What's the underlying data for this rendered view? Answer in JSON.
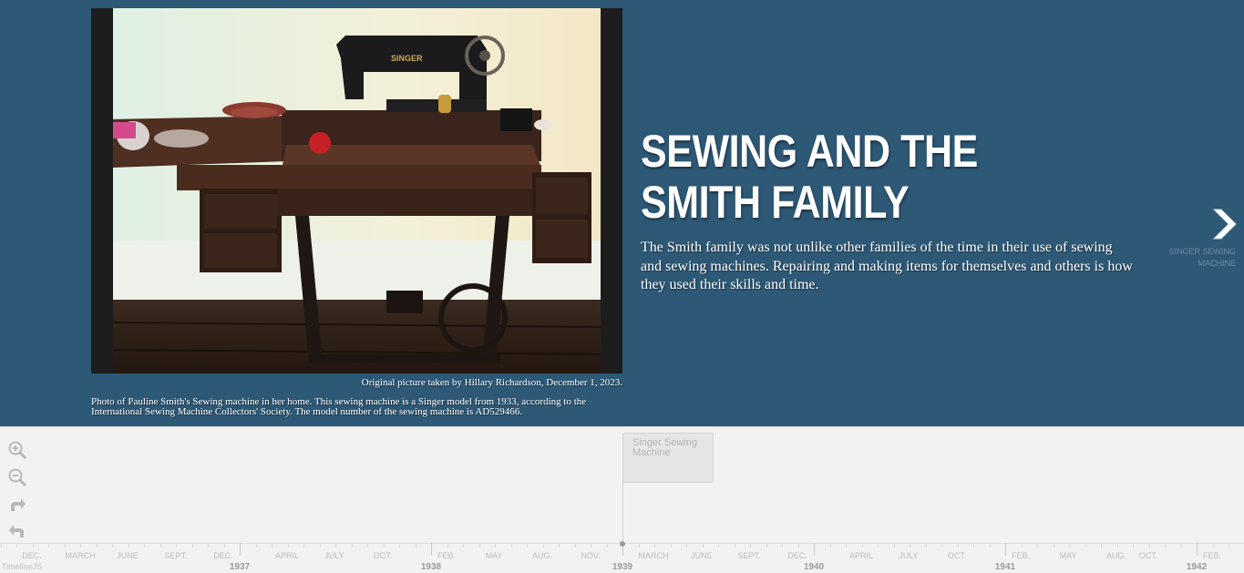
{
  "slide": {
    "headline": "SEWING AND THE SMITH FAMILY",
    "text": "The Smith family was not unlike other families of the time in their use of sewing and sewing machines. Repairing and making items for themselves and others is how they used their skills and time.",
    "media_credit": "Original picture taken by Hillary Richardson, December 1, 2023.",
    "media_caption": "Photo of Pauline Smith's Sewing machine in her home. This sewing machine is a Singer model from 1933, according to the International Sewing Machine Collectors' Society. The model number of the sewing machine is AD529466.",
    "machine_brand": "SINGER"
  },
  "next_nav": {
    "title": "SINGER SEWING MACHINE",
    "icon": "chevron-right-icon"
  },
  "timenav": {
    "tools": [
      "zoom-in-icon",
      "zoom-out-icon",
      "redo-icon",
      "undo-icon"
    ],
    "marker_label": "Singer Sewing Machine",
    "months": [
      "DEC.",
      "MARCH",
      "JUNE",
      "SEPT.",
      "DEC.",
      "APRIL",
      "JULY",
      "OCT.",
      "FEB.",
      "MAY",
      "AUG.",
      "NOV.",
      "MARCH",
      "JUNE",
      "SEPT.",
      "DEC.",
      "APRIL",
      "JULY",
      "OCT.",
      "FEB.",
      "MAY",
      "AUG.",
      "OCT.",
      "FEB."
    ],
    "years": [
      "1937",
      "1938",
      "1939",
      "1940",
      "1941",
      "1942"
    ],
    "brand": "TimelineJS"
  },
  "colors": {
    "slide_bg": "#2d5876",
    "timenav_bg": "#f2f2f2"
  }
}
